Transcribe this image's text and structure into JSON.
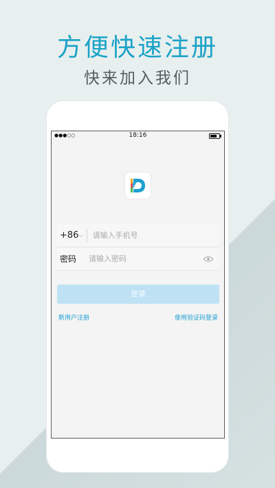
{
  "headline": "方便快速注册",
  "subline": "快来加入我们",
  "status_bar": {
    "signal": "●●●○○",
    "time": "18:16"
  },
  "login_form": {
    "country_code": "+86",
    "phone_placeholder": "请输入手机号",
    "password_label": "密码",
    "password_placeholder": "请输入密码",
    "login_button": "登录",
    "register_link": "新用户注册",
    "sms_login_link": "使用验证码登录"
  },
  "icons": {
    "logo": "app-logo-d",
    "eye": "eye-icon",
    "chevron": "chevron-down-icon"
  },
  "colors": {
    "accent": "#1aa3c6",
    "link": "#1f9fd1",
    "login_button_disabled": "#bfe1f4",
    "background": "#e8efef"
  }
}
